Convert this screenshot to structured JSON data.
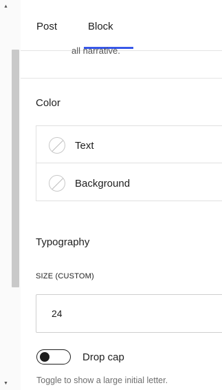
{
  "tabs": {
    "post_label": "Post",
    "block_label": "Block",
    "active": "Block"
  },
  "previous_section": {
    "text": "all narrative."
  },
  "color": {
    "title": "Color",
    "items": [
      {
        "label": "Text",
        "icon": "empty-swatch-icon"
      },
      {
        "label": "Background",
        "icon": "empty-swatch-icon"
      }
    ]
  },
  "typography": {
    "title": "Typography",
    "size_label": "SIZE (CUSTOM)",
    "size_value": "24",
    "drop_cap_label": "Drop cap",
    "drop_cap_enabled": false,
    "drop_cap_help": "Toggle to show a large initial letter."
  },
  "scrollbar": {
    "up_icon": "triangle-up-icon",
    "down_icon": "triangle-down-icon"
  },
  "colors": {
    "accent": "#3858e9",
    "text": "#1e1e1e",
    "muted": "#6e6e6e",
    "border": "#e0e0e0"
  }
}
